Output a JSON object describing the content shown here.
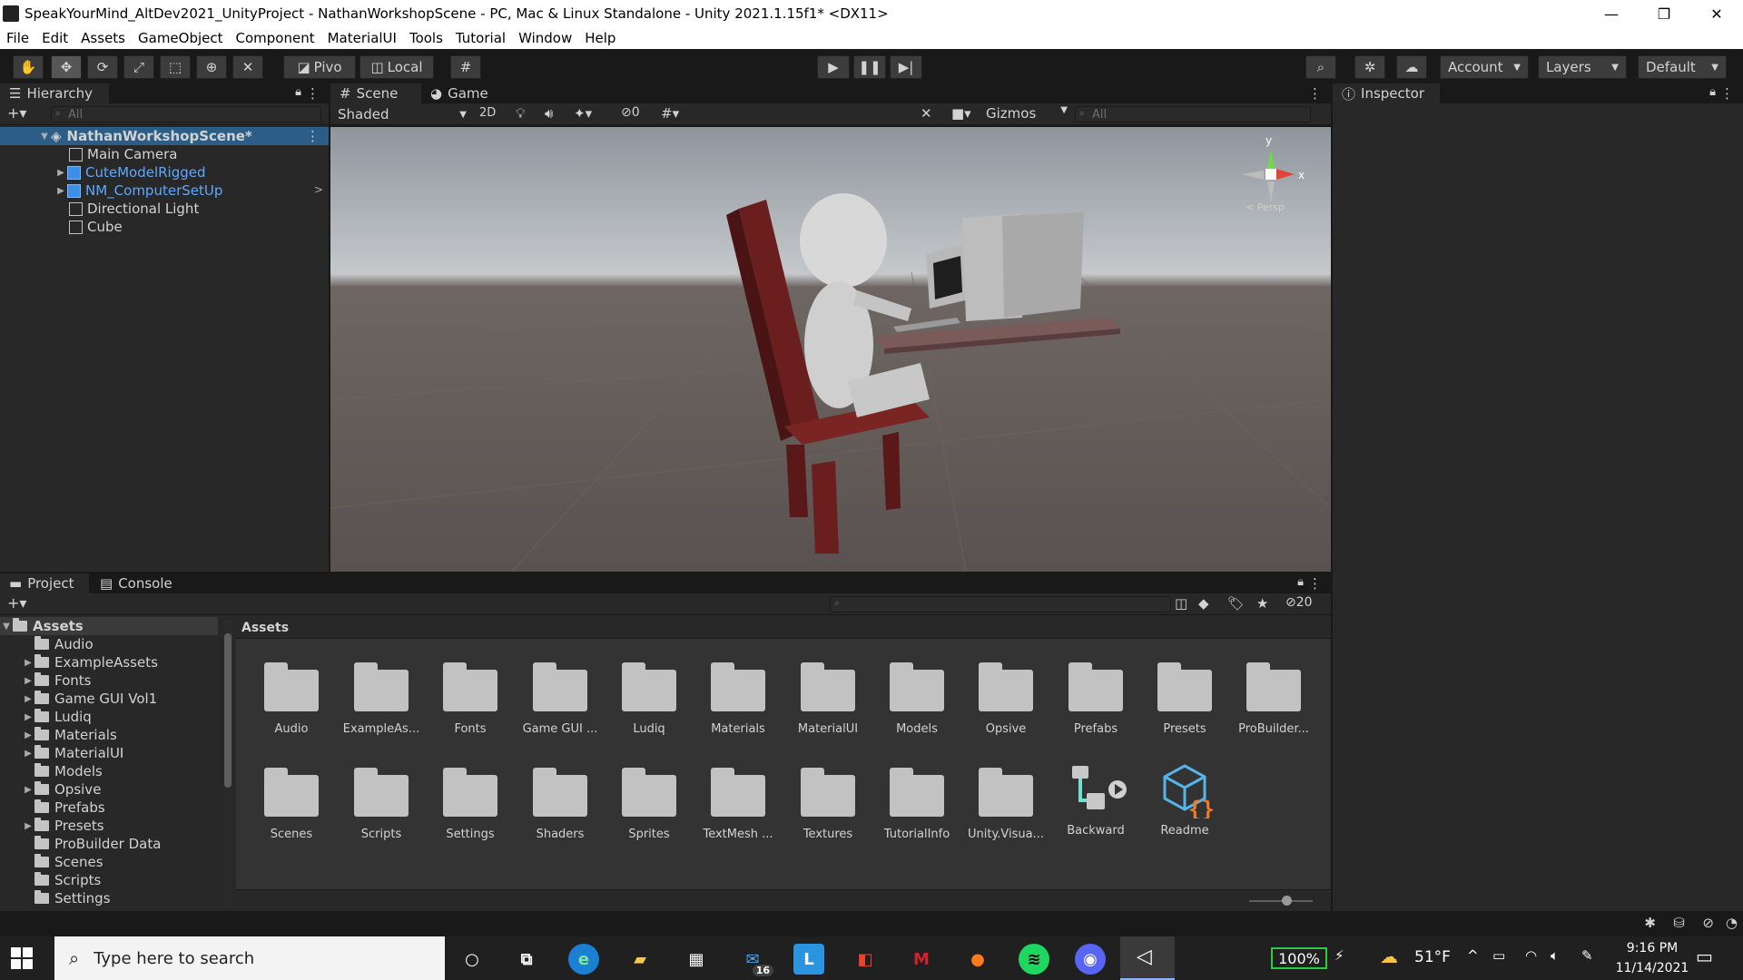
{
  "window": {
    "title": "SpeakYourMind_AltDev2021_UnityProject - NathanWorkshopScene - PC, Mac & Linux Standalone - Unity 2021.1.15f1* <DX11>",
    "minimize": "—",
    "maximize": "❐",
    "close": "✕"
  },
  "menu": [
    "File",
    "Edit",
    "Assets",
    "GameObject",
    "Component",
    "MaterialUI",
    "Tools",
    "Tutorial",
    "Window",
    "Help"
  ],
  "toolbar": {
    "pivot": "Pivo",
    "local": "Local",
    "account": "Account",
    "layers": "Layers",
    "layout": "Default"
  },
  "hierarchy": {
    "tab": "Hierarchy",
    "search_placeholder": "All",
    "scene": "NathanWorkshopScene*",
    "items": [
      {
        "label": "Main Camera",
        "prefab": false,
        "expandable": false
      },
      {
        "label": "CuteModelRigged",
        "prefab": true,
        "expandable": true
      },
      {
        "label": "NM_ComputerSetUp",
        "prefab": true,
        "expandable": true
      },
      {
        "label": "Directional Light",
        "prefab": false,
        "expandable": false
      },
      {
        "label": "Cube",
        "prefab": false,
        "expandable": false
      }
    ]
  },
  "scene_view": {
    "tabs": [
      "Scene",
      "Game"
    ],
    "shading": "Shaded",
    "mode_2d": "2D",
    "hidden_count": "0",
    "gizmos": "Gizmos",
    "search_placeholder": "All",
    "axis_y": "y",
    "axis_x": "x",
    "persp": "< Persp"
  },
  "inspector": {
    "tab": "Inspector"
  },
  "project": {
    "tabs": [
      "Project",
      "Console"
    ],
    "hidden_count": "20",
    "breadcrumb": "Assets",
    "tree_root": "Assets",
    "tree": [
      {
        "label": "Audio",
        "expandable": false
      },
      {
        "label": "ExampleAssets",
        "expandable": true
      },
      {
        "label": "Fonts",
        "expandable": true
      },
      {
        "label": "Game GUI Vol1",
        "expandable": true
      },
      {
        "label": "Ludiq",
        "expandable": true
      },
      {
        "label": "Materials",
        "expandable": true
      },
      {
        "label": "MaterialUI",
        "expandable": true
      },
      {
        "label": "Models",
        "expandable": false
      },
      {
        "label": "Opsive",
        "expandable": true
      },
      {
        "label": "Prefabs",
        "expandable": false
      },
      {
        "label": "Presets",
        "expandable": true
      },
      {
        "label": "ProBuilder Data",
        "expandable": false
      },
      {
        "label": "Scenes",
        "expandable": false
      },
      {
        "label": "Scripts",
        "expandable": false
      },
      {
        "label": "Settings",
        "expandable": false
      }
    ],
    "assets_row1": [
      "Audio",
      "ExampleAs...",
      "Fonts",
      "Game GUI ...",
      "Ludiq",
      "Materials",
      "MaterialUI",
      "Models",
      "Opsive",
      "Prefabs",
      "Presets",
      "ProBuilder..."
    ],
    "assets_row2": [
      "Scenes",
      "Scripts",
      "Settings",
      "Shaders",
      "Sprites",
      "TextMesh ...",
      "Textures",
      "TutorialInfo",
      "Unity.Visua..."
    ],
    "special_assets": [
      {
        "label": "Backward",
        "icon": "visual-script-icon"
      },
      {
        "label": "Readme",
        "icon": "readme-icon"
      }
    ]
  },
  "taskbar": {
    "search_placeholder": "Type here to search",
    "mail_badge": "16",
    "battery": "100%",
    "weather": "51°F",
    "time": "9:16 PM",
    "date": "11/14/2021"
  },
  "colors": {
    "editor_bg": "#282828",
    "prefab_blue": "#5fa8ff",
    "scene_sky": "#aeb4ba",
    "scene_ground": "#5b5450"
  }
}
